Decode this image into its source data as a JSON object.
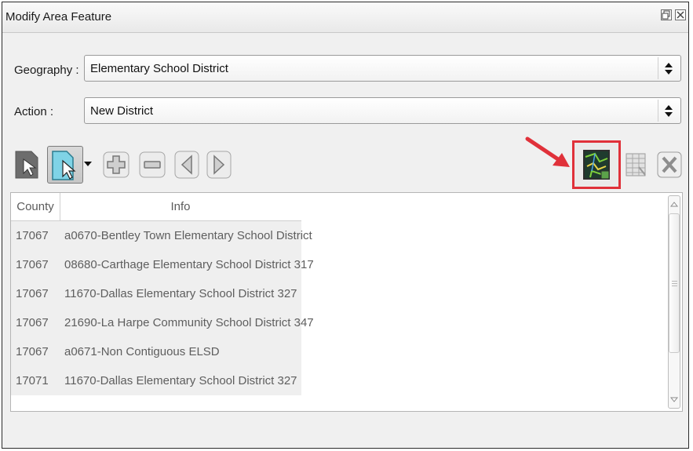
{
  "window": {
    "title": "Modify Area Feature",
    "float_icon": "float-icon",
    "close_icon": "close-icon"
  },
  "geography": {
    "label": "Geography :",
    "value": "Elementary School District"
  },
  "action": {
    "label": "Action :",
    "value": "New District"
  },
  "toolbar": {
    "icons": [
      "select-feature-icon",
      "select-by-area-icon",
      "dropdown-arrow-icon",
      "add-icon",
      "remove-icon",
      "previous-icon",
      "next-icon",
      "map-view-icon",
      "table-view-icon",
      "clear-icon"
    ],
    "highlight_color": "#e0313a",
    "arrow_color": "#e0313a"
  },
  "table": {
    "columns": [
      "County",
      "Info"
    ],
    "rows": [
      {
        "county": "17067",
        "info": "a0670-Bentley Town Elementary School District"
      },
      {
        "county": "17067",
        "info": "08680-Carthage Elementary School District 317"
      },
      {
        "county": "17067",
        "info": "11670-Dallas Elementary School District 327"
      },
      {
        "county": "17067",
        "info": "21690-La Harpe Community School District 347"
      },
      {
        "county": "17067",
        "info": "a0671-Non Contiguous ELSD"
      },
      {
        "county": "17071",
        "info": "11670-Dallas Elementary School District 327"
      }
    ]
  }
}
